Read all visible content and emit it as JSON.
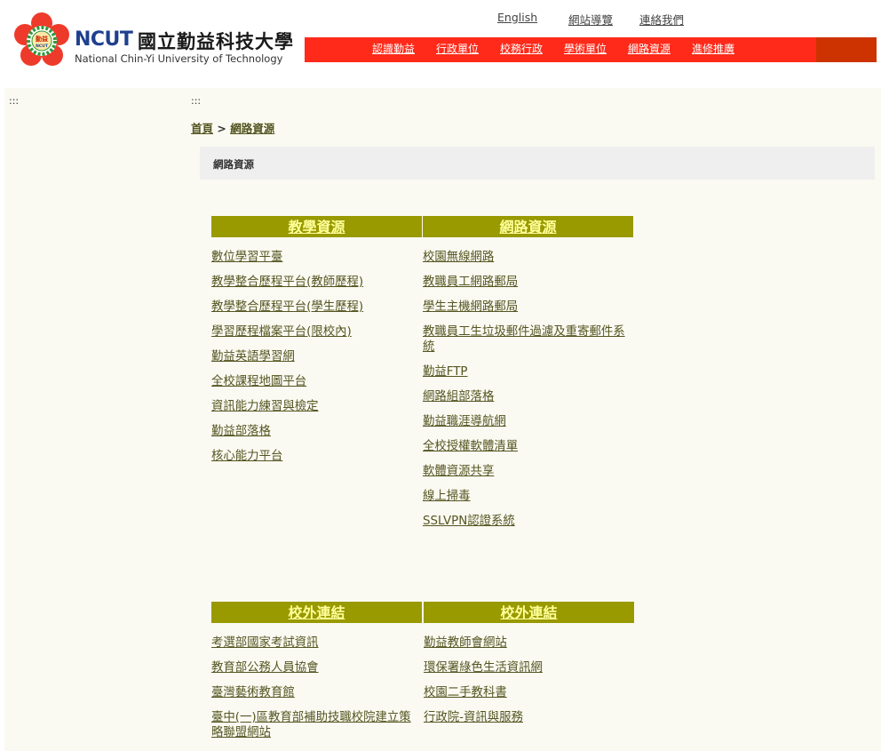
{
  "header": {
    "logo_badge_text": "勤益",
    "logo_badge_sub": "NCUT",
    "logo_ncut": "NCUT",
    "logo_zh": "國立勤益科技大學",
    "logo_en": "National Chin-Yi University of Technology",
    "top_links": [
      "English",
      "網站導覽",
      "連絡我們"
    ],
    "nav": [
      "認識勤益",
      "行政單位",
      "校務行政",
      "學術單位",
      "網路資源",
      "進修推廣"
    ],
    "colors": {
      "nav_bg": "#ff2a1a",
      "nav_end": "#cc3300"
    }
  },
  "main": {
    "dots_left": ":::",
    "dots_right": ":::",
    "breadcrumb_home": "首頁",
    "breadcrumb_sep": ">",
    "breadcrumb_current": "網路資源",
    "page_heading": "網路資源"
  },
  "sections": [
    {
      "title": "教學資源",
      "items": [
        "數位學習平臺",
        "教學整合歷程平台(教師歷程)",
        "教學整合歷程平台(學生歷程)",
        "學習歷程檔案平台(限校內)",
        "勤益英語學習網",
        "全校課程地圖平台",
        "資訊能力練習與檢定",
        "勤益部落格",
        "核心能力平台"
      ]
    },
    {
      "title": "網路資源",
      "items": [
        "校園無線網路",
        "教職員工網路郵局",
        "學生主機網路郵局",
        "教職員工生垃圾郵件過濾及重寄郵件系統",
        "勤益FTP",
        "網路組部落格",
        "勤益職涯導航網",
        "全校授權軟體清單",
        "軟體資源共享",
        "線上掃毒",
        "SSLVPN認證系統"
      ]
    },
    {
      "title": "校外連結",
      "items": [
        "考選部國家考試資訊",
        "教育部公務人員協會",
        "臺灣藝術教育館",
        "臺中(一)區教育部補助技職校院建立策略聯盟網站"
      ]
    },
    {
      "title": "校外連結",
      "items": [
        "勤益教師會網站",
        "環保署綠色生活資訊網",
        "校園二手教科書",
        "行政院-資訊與服務"
      ]
    }
  ]
}
